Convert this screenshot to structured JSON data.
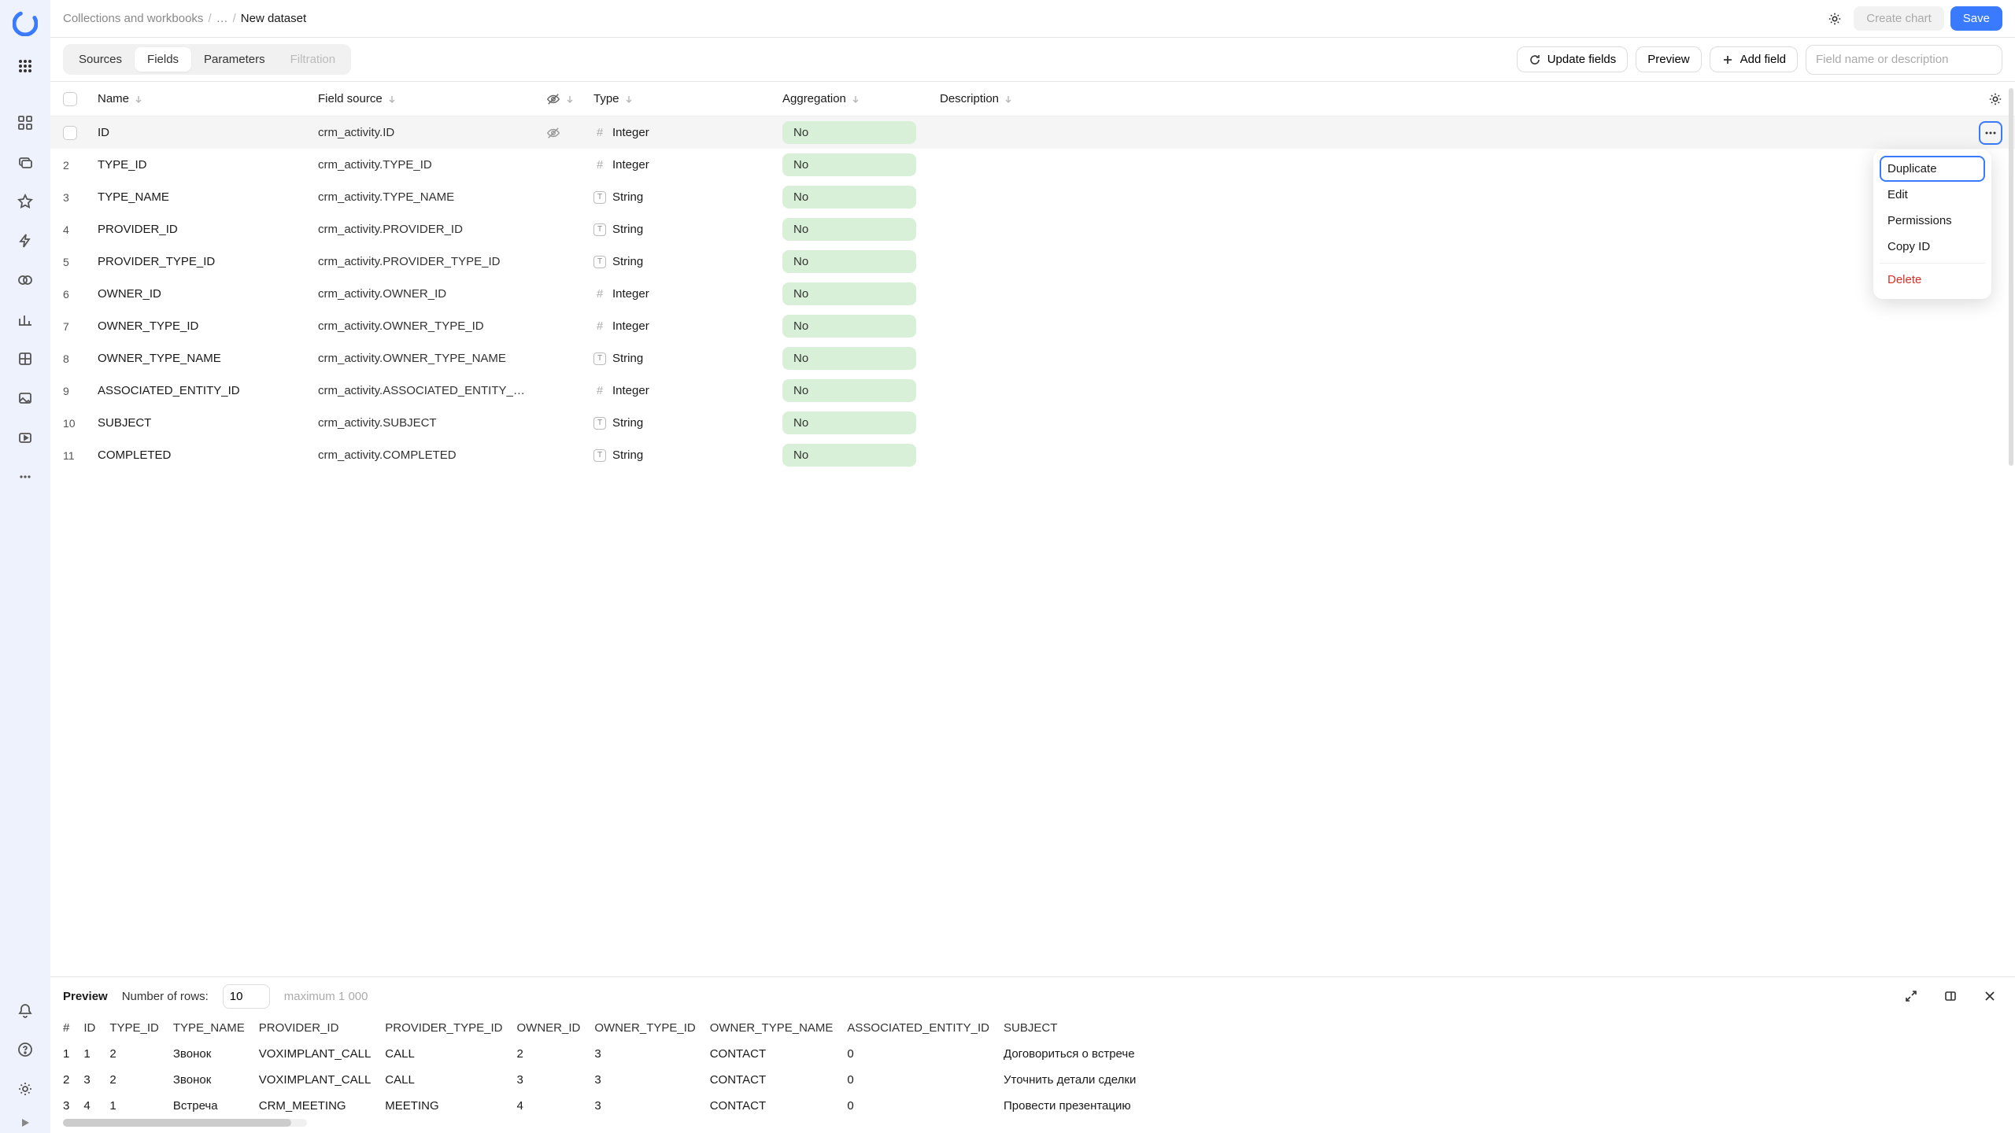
{
  "breadcrumb": {
    "root": "Collections and workbooks",
    "mid": "…",
    "current": "New dataset"
  },
  "topbar": {
    "create_chart": "Create chart",
    "save": "Save"
  },
  "tabs": {
    "sources": "Sources",
    "fields": "Fields",
    "parameters": "Parameters",
    "filtration": "Filtration"
  },
  "toolbar": {
    "update_fields": "Update fields",
    "preview": "Preview",
    "add_field": "Add field",
    "search_placeholder": "Field name or description"
  },
  "columns": {
    "name": "Name",
    "source": "Field source",
    "type": "Type",
    "aggregation": "Aggregation",
    "description": "Description"
  },
  "fields": [
    {
      "num": "",
      "name": "ID",
      "source": "crm_activity.ID",
      "hidden": true,
      "type": "Integer",
      "type_kind": "int",
      "agg": "No",
      "active": true
    },
    {
      "num": "2",
      "name": "TYPE_ID",
      "source": "crm_activity.TYPE_ID",
      "type": "Integer",
      "type_kind": "int",
      "agg": "No"
    },
    {
      "num": "3",
      "name": "TYPE_NAME",
      "source": "crm_activity.TYPE_NAME",
      "type": "String",
      "type_kind": "str",
      "agg": "No"
    },
    {
      "num": "4",
      "name": "PROVIDER_ID",
      "source": "crm_activity.PROVIDER_ID",
      "type": "String",
      "type_kind": "str",
      "agg": "No"
    },
    {
      "num": "5",
      "name": "PROVIDER_TYPE_ID",
      "source": "crm_activity.PROVIDER_TYPE_ID",
      "type": "String",
      "type_kind": "str",
      "agg": "No"
    },
    {
      "num": "6",
      "name": "OWNER_ID",
      "source": "crm_activity.OWNER_ID",
      "type": "Integer",
      "type_kind": "int",
      "agg": "No"
    },
    {
      "num": "7",
      "name": "OWNER_TYPE_ID",
      "source": "crm_activity.OWNER_TYPE_ID",
      "type": "Integer",
      "type_kind": "int",
      "agg": "No"
    },
    {
      "num": "8",
      "name": "OWNER_TYPE_NAME",
      "source": "crm_activity.OWNER_TYPE_NAME",
      "type": "String",
      "type_kind": "str",
      "agg": "No"
    },
    {
      "num": "9",
      "name": "ASSOCIATED_ENTITY_ID",
      "source": "crm_activity.ASSOCIATED_ENTITY_…",
      "type": "Integer",
      "type_kind": "int",
      "agg": "No"
    },
    {
      "num": "10",
      "name": "SUBJECT",
      "source": "crm_activity.SUBJECT",
      "type": "String",
      "type_kind": "str",
      "agg": "No"
    },
    {
      "num": "11",
      "name": "COMPLETED",
      "source": "crm_activity.COMPLETED",
      "type": "String",
      "type_kind": "str",
      "agg": "No"
    }
  ],
  "context_menu": {
    "duplicate": "Duplicate",
    "edit": "Edit",
    "permissions": "Permissions",
    "copy_id": "Copy ID",
    "delete": "Delete"
  },
  "preview": {
    "title": "Preview",
    "rows_label": "Number of rows:",
    "rows_value": "10",
    "max": "maximum 1 000",
    "headers": [
      "#",
      "ID",
      "TYPE_ID",
      "TYPE_NAME",
      "PROVIDER_ID",
      "PROVIDER_TYPE_ID",
      "OWNER_ID",
      "OWNER_TYPE_ID",
      "OWNER_TYPE_NAME",
      "ASSOCIATED_ENTITY_ID",
      "SUBJECT"
    ],
    "rows": [
      [
        "1",
        "1",
        "2",
        "Звонок",
        "VOXIMPLANT_CALL",
        "CALL",
        "2",
        "3",
        "CONTACT",
        "0",
        "Договориться о встрече"
      ],
      [
        "2",
        "3",
        "2",
        "Звонок",
        "VOXIMPLANT_CALL",
        "CALL",
        "3",
        "3",
        "CONTACT",
        "0",
        "Уточнить детали сделки"
      ],
      [
        "3",
        "4",
        "1",
        "Встреча",
        "CRM_MEETING",
        "MEETING",
        "4",
        "3",
        "CONTACT",
        "0",
        "Провести презентацию"
      ]
    ]
  }
}
